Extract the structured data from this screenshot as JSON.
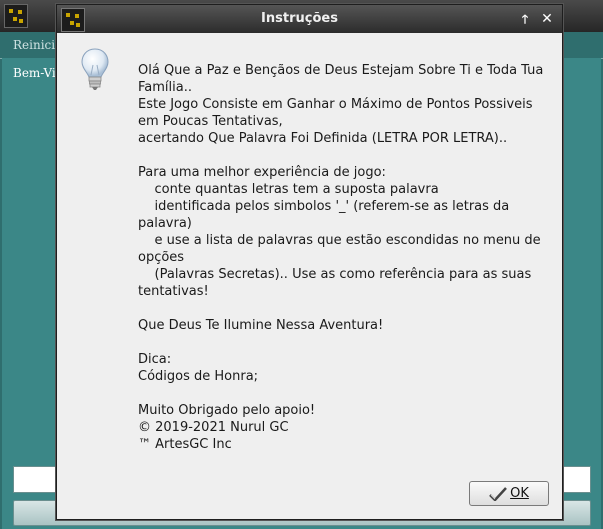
{
  "background_app": {
    "menu_item": "Reinicia",
    "welcome_text": "Bem-Vi"
  },
  "dialog": {
    "title": "Instruções",
    "maximize_glyph": "🡑",
    "close_glyph": "✕",
    "icon": "lightbulb-icon",
    "message_lines": [
      "Olá Que a Paz e Bençãos de Deus Estejam Sobre Ti e Toda Tua Família..",
      "Este Jogo Consiste em Ganhar o Máximo de Pontos Possiveis em Poucas Tentativas,",
      "acertando Que Palavra Foi Definida (LETRA POR LETRA)..",
      "",
      "Para uma melhor experiência de jogo:",
      "    conte quantas letras tem a suposta palavra",
      "    identificada pelos simbolos '_' (referem-se as letras da palavra)",
      "    e use a lista de palavras que estão escondidas no menu de opções",
      "    (Palavras Secretas).. Use as como referência para as suas tentativas!",
      "",
      "Que Deus Te Ilumine Nessa Aventura!",
      "",
      "Dica:",
      "Códigos de Honra;",
      "",
      "Muito Obrigado pelo apoio!",
      "© 2019-2021 Nurul GC",
      "™ ArtesGC Inc"
    ],
    "ok_button": {
      "label": "OK",
      "icon": "checkmark-icon"
    }
  },
  "colors": {
    "background_app": "#3b8787",
    "dialog_body": "#efefef",
    "titlebar": "#2c2c2c"
  }
}
